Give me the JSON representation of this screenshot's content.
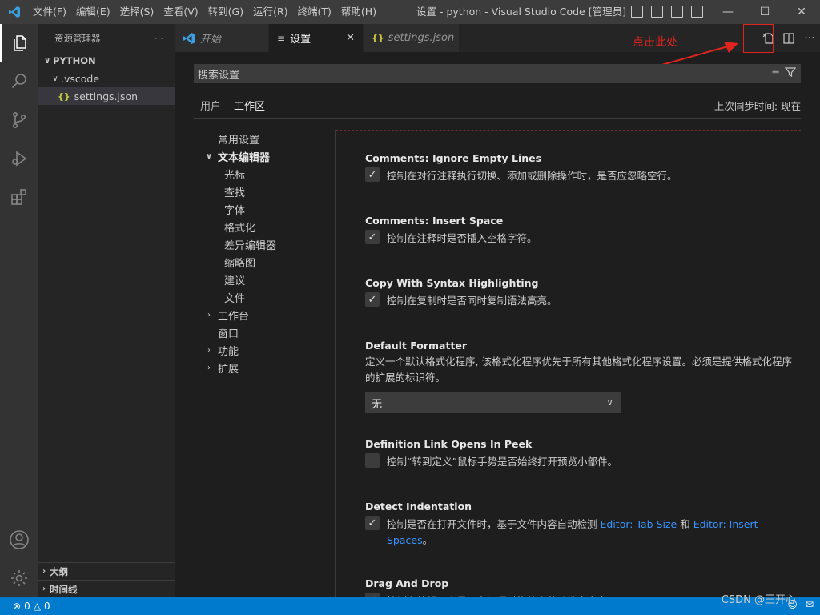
{
  "window": {
    "title": "设置 - python - Visual Studio Code [管理员]",
    "menu": [
      "文件(F)",
      "编辑(E)",
      "选择(S)",
      "查看(V)",
      "转到(G)",
      "运行(R)",
      "终端(T)",
      "帮助(H)"
    ]
  },
  "sidebar": {
    "header": "资源管理器",
    "more": "···",
    "folder": "PYTHON",
    "subfolder": ".vscode",
    "file": "settings.json",
    "outline": "大纲",
    "timeline": "时间线"
  },
  "tabs": [
    {
      "label": "开始"
    },
    {
      "label": "设置"
    },
    {
      "label": "settings.json"
    }
  ],
  "annotation": {
    "text": "点击此处"
  },
  "settings_editor": {
    "search_placeholder": "搜索设置",
    "scope_user": "用户",
    "scope_workspace": "工作区",
    "sync_status": "上次同步时间: 现在",
    "toc": [
      {
        "label": "常用设置"
      },
      {
        "label": "文本编辑器"
      },
      {
        "label": "光标"
      },
      {
        "label": "查找"
      },
      {
        "label": "字体"
      },
      {
        "label": "格式化"
      },
      {
        "label": "差异编辑器"
      },
      {
        "label": "缩略图"
      },
      {
        "label": "建议"
      },
      {
        "label": "文件"
      },
      {
        "label": "工作台"
      },
      {
        "label": "窗口"
      },
      {
        "label": "功能"
      },
      {
        "label": "扩展"
      }
    ],
    "items": [
      {
        "category": "Comments: ",
        "name": "Ignore Empty Lines",
        "desc": "控制在对行注释执行切换、添加或删除操作时，是否应忽略空行。",
        "checked": true
      },
      {
        "category": "Comments: ",
        "name": "Insert Space",
        "desc": "控制在注释时是否插入空格字符。",
        "checked": true
      },
      {
        "category": "",
        "name": "Copy With Syntax Highlighting",
        "desc": "控制在复制时是否同时复制语法高亮。",
        "checked": true
      },
      {
        "category": "",
        "name": "Default Formatter",
        "desc": "定义一个默认格式化程序, 该格式化程序优先于所有其他格式化程序设置。必须是提供格式化程序的扩展的标识符。",
        "dropdown_value": "无"
      },
      {
        "category": "",
        "name": "Definition Link Opens In Peek",
        "desc": "控制“转到定义”鼠标手势是否始终打开预览小部件。",
        "checked": false
      },
      {
        "category": "",
        "name": "Detect Indentation",
        "desc_before": "控制是否在打开文件时，基于文件内容自动检测 ",
        "link1": "Editor: Tab Size",
        "desc_mid": " 和 ",
        "link2": "Editor: Insert Spaces",
        "desc_after": "。",
        "checked": true
      },
      {
        "category": "",
        "name": "Drag And Drop",
        "desc": "控制在编辑器中是否允许通过拖放来移动选中内容。",
        "checked": true
      }
    ]
  },
  "statusbar": {
    "errors": "0",
    "warnings": "0",
    "watermark": "CSDN @王开心"
  },
  "colors": {
    "accent": "#007acc",
    "annotation": "#e0251e",
    "link": "#3794ff"
  }
}
